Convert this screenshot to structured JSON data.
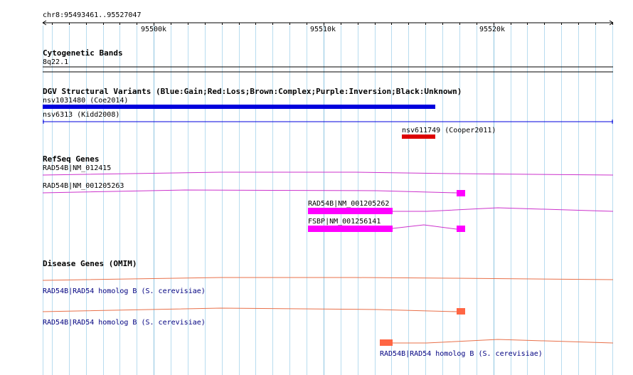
{
  "region": {
    "label": "chr8:95493461..95527047",
    "start": 95493461,
    "end": 95527047
  },
  "ruler": {
    "ticks": [
      {
        "pos": 95500000,
        "label": "95500k"
      },
      {
        "pos": 95510000,
        "label": "95510k"
      },
      {
        "pos": 95520000,
        "label": "95520k"
      }
    ]
  },
  "tracks": {
    "cytoband": {
      "title": "Cytogenetic Bands",
      "band": "8q22.1"
    },
    "dgv": {
      "title": "DGV Structural Variants (Blue:Gain;Red:Loss;Brown:Complex;Purple:Inversion;Black:Unknown)",
      "features": [
        {
          "label": "nsv1031480 (Coe2014)",
          "color": "#0000dd",
          "start": 95493461,
          "end": 95516510,
          "style": "bar"
        },
        {
          "label": "nsv6313 (Kidd2008)",
          "color": "#0000dd",
          "start": 95493461,
          "end": 95527047,
          "style": "line"
        },
        {
          "label": "nsv611749 (Cooper2011)",
          "color": "#dd0000",
          "start": 95514540,
          "end": 95516510,
          "style": "bar"
        }
      ]
    },
    "refseq": {
      "title": "RefSeq Genes",
      "color": "#cc33cc",
      "exon_color": "#ff00ff",
      "genes": [
        {
          "label": "RAD54B|NM_012415"
        },
        {
          "label": "RAD54B|NM_001205263"
        },
        {
          "label": "RAD54B|NM_001205262"
        },
        {
          "label": "FSBP|NM_001256141"
        }
      ]
    },
    "omim": {
      "title": "Disease Genes (OMIM)",
      "color": "#e8704a",
      "genes": [
        {
          "label": "RAD54B|RAD54 homolog B (S. cerevisiae)"
        },
        {
          "label": "RAD54B|RAD54 homolog B (S. cerevisiae)"
        },
        {
          "label": "RAD54B|RAD54 homolog B (S. cerevisiae)"
        }
      ]
    }
  }
}
